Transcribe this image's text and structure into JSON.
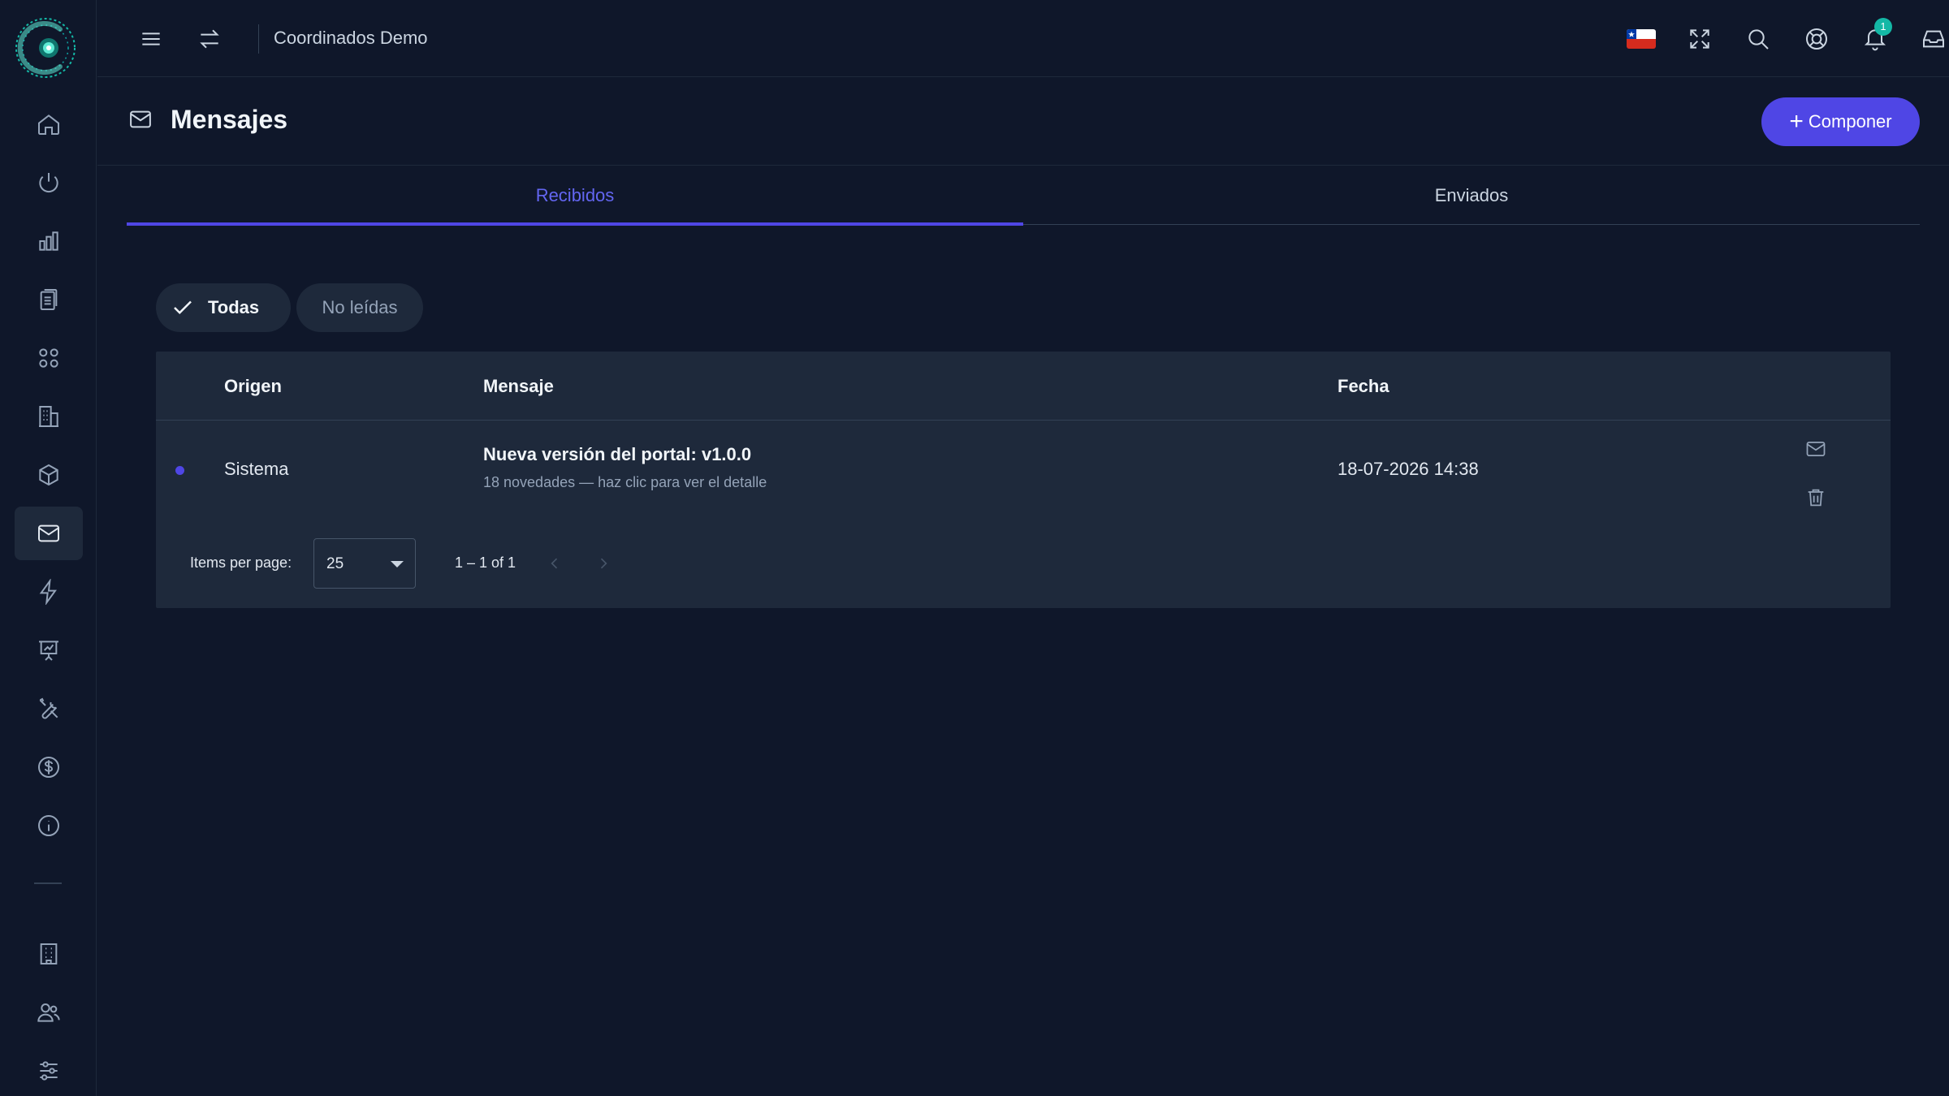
{
  "app": {
    "org_name": "Coordinados Demo"
  },
  "sidebar": {
    "items": [
      {
        "name": "home-icon"
      },
      {
        "name": "power-icon"
      },
      {
        "name": "bar-chart-icon"
      },
      {
        "name": "clipboard-icon"
      },
      {
        "name": "grid-icon"
      },
      {
        "name": "building-icon"
      },
      {
        "name": "cube-icon"
      },
      {
        "name": "mail-icon",
        "active": true
      },
      {
        "name": "bolt-icon"
      },
      {
        "name": "presentation-chart-icon"
      },
      {
        "name": "tools-icon"
      },
      {
        "name": "dollar-icon"
      },
      {
        "name": "info-icon"
      },
      {
        "name": "office-building-icon"
      },
      {
        "name": "users-icon"
      },
      {
        "name": "sliders-icon"
      }
    ]
  },
  "topbar": {
    "notification_count": "1",
    "icons": [
      "menu-icon",
      "swap-icon",
      "chile-flag-icon",
      "fullscreen-icon",
      "search-icon",
      "support-icon",
      "bell-icon",
      "inbox-icon",
      "user-icon"
    ]
  },
  "page": {
    "title": "Mensajes",
    "compose_label": "Componer"
  },
  "tabs": [
    {
      "label": "Recibidos",
      "active": true
    },
    {
      "label": "Enviados",
      "active": false
    }
  ],
  "filters": {
    "all_label": "Todas",
    "unread_label": "No leídas"
  },
  "table": {
    "headers": {
      "origin": "Origen",
      "message": "Mensaje",
      "date": "Fecha"
    },
    "rows": [
      {
        "unread": true,
        "origin": "Sistema",
        "title": "Nueva versión del portal: v1.0.0",
        "subtitle": "18 novedades — haz clic para ver el detalle",
        "date": "18-07-2026 14:38"
      }
    ]
  },
  "pagination": {
    "items_per_page_label": "Items per page:",
    "page_size": "25",
    "range": "1 – 1 of 1"
  },
  "colors": {
    "accent": "#4f46e5",
    "background": "#0f172a",
    "surface": "#1e293b",
    "badge": "#14b8a6"
  }
}
